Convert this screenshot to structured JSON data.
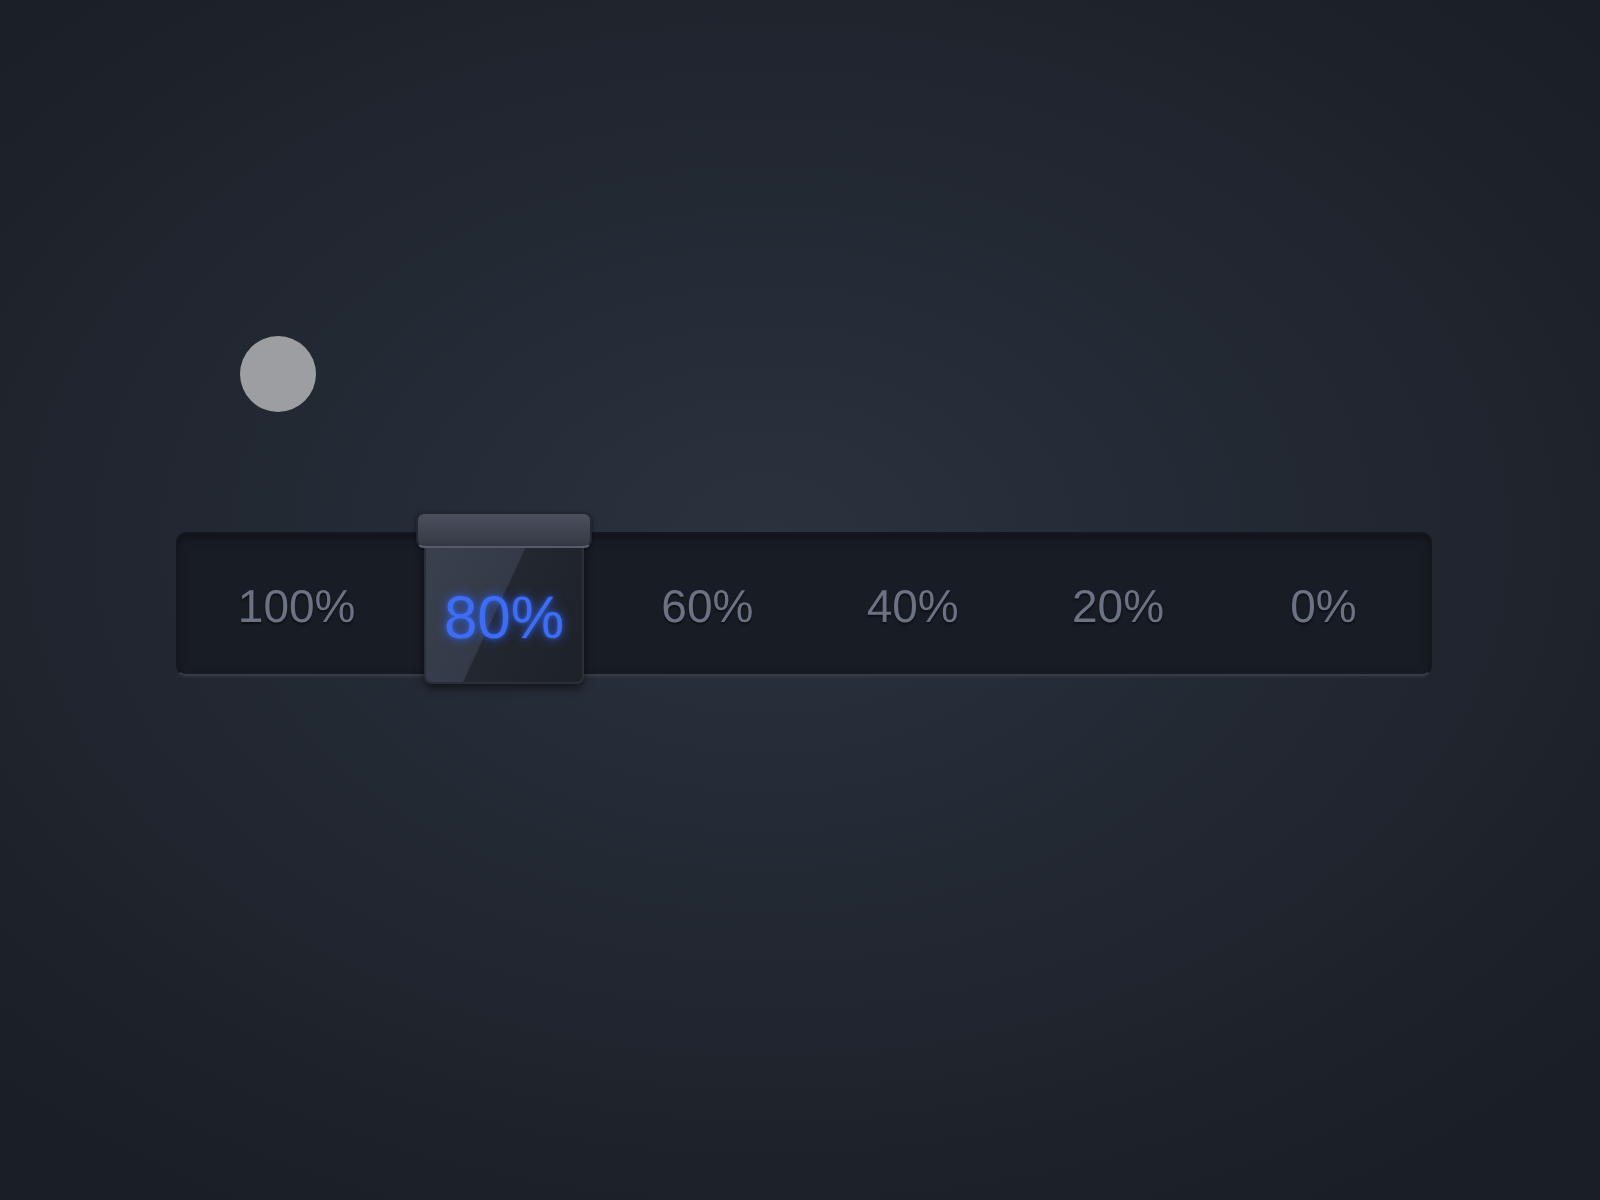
{
  "selector": {
    "options": [
      {
        "label": "100%",
        "selected": false
      },
      {
        "label": "80%",
        "selected": true
      },
      {
        "label": "60%",
        "selected": false
      },
      {
        "label": "40%",
        "selected": false
      },
      {
        "label": "20%",
        "selected": false
      },
      {
        "label": "0%",
        "selected": false
      }
    ]
  }
}
